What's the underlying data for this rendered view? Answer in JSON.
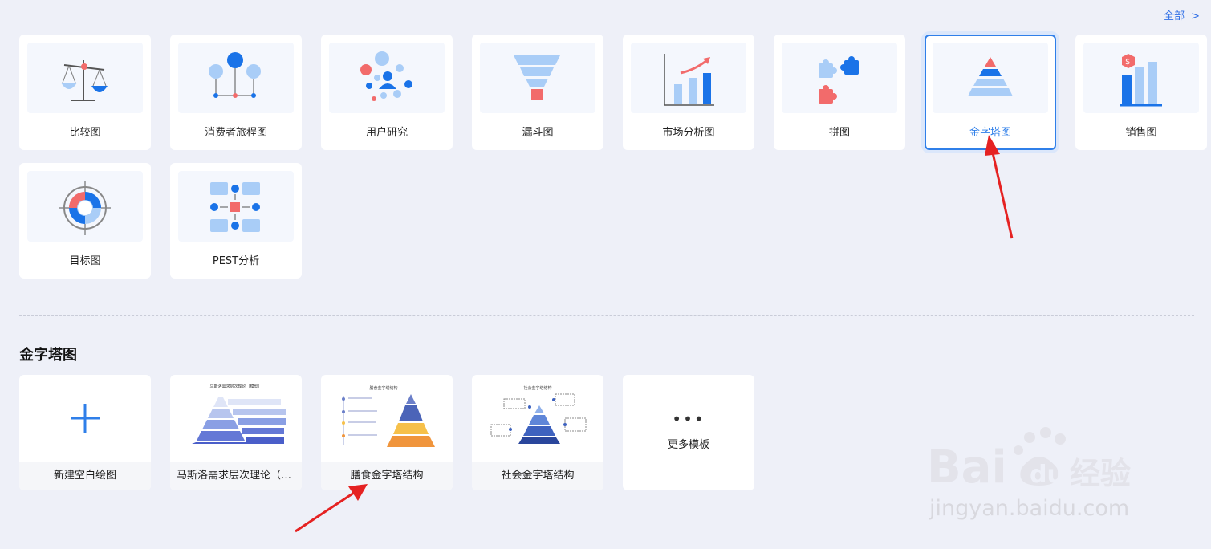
{
  "header": {
    "all_label": "全部",
    "all_arrow": ">"
  },
  "categories": [
    {
      "label": "比较图",
      "icon": "balance-scale-icon"
    },
    {
      "label": "消费者旅程图",
      "icon": "journey-nodes-icon"
    },
    {
      "label": "用户研究",
      "icon": "user-research-icon"
    },
    {
      "label": "漏斗图",
      "icon": "funnel-icon"
    },
    {
      "label": "市场分析图",
      "icon": "market-chart-icon"
    },
    {
      "label": "拼图",
      "icon": "puzzle-icon"
    },
    {
      "label": "金字塔图",
      "icon": "pyramid-icon",
      "selected": true
    },
    {
      "label": "销售图",
      "icon": "sales-chart-icon"
    },
    {
      "label": "目标图",
      "icon": "target-icon"
    },
    {
      "label": "PEST分析",
      "icon": "pest-icon"
    }
  ],
  "section": {
    "title": "金字塔图"
  },
  "templates": [
    {
      "label": "新建空白绘图"
    },
    {
      "label": "马斯洛需求层次理论（金字塔图）",
      "thumb_title": "马斯洛需求层次理论（模型）"
    },
    {
      "label": "膳食金字塔结构",
      "thumb_title": "膳食金字塔结构"
    },
    {
      "label": "社会金字塔结构",
      "thumb_title": "社会金字塔结构"
    }
  ],
  "more": {
    "dots": "•••",
    "label": "更多模板"
  },
  "watermark": {
    "brand_a": "Bai",
    "brand_b": "du",
    "brand_cn": "经验",
    "url": "jingyan.baidu.com"
  },
  "colors": {
    "accent": "#2f7fe9",
    "blue": "#1a73e8",
    "light_blue": "#a9cdf7",
    "red": "#f26b6b"
  }
}
